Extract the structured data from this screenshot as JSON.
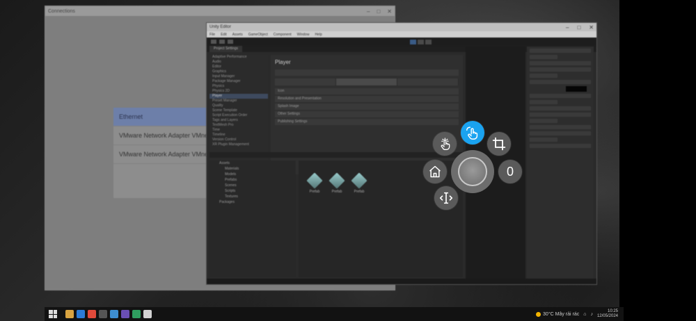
{
  "back_window": {
    "title": "Connections",
    "network_items": [
      {
        "label": "Ethernet",
        "selected": true
      },
      {
        "label": "VMware Network Adapter VMnet1",
        "selected": false
      },
      {
        "label": "VMware Network Adapter VMnet8",
        "selected": false
      }
    ]
  },
  "unity_window": {
    "title": "Unity Editor",
    "menu": [
      "File",
      "Edit",
      "Assets",
      "GameObject",
      "Component",
      "Window",
      "Help"
    ],
    "tabs": [
      "Project Settings"
    ],
    "settings_list": [
      "Adaptive Performance",
      "Audio",
      "Editor",
      "Graphics",
      "Input Manager",
      "Package Manager",
      "Physics",
      "Physics 2D",
      "Player",
      "Preset Manager",
      "Quality",
      "Scene Template",
      "Script Execution Order",
      "Tags and Layers",
      "TextMesh Pro",
      "Time",
      "Timeline",
      "Version Control",
      "XR Plugin Management"
    ],
    "selected_setting": "Player",
    "player_title": "Player",
    "player_sections": [
      "Icon",
      "Resolution and Presentation",
      "Splash Image",
      "Other Settings",
      "Publishing Settings"
    ],
    "hierarchy_rows": [
      "Assets",
      "Materials",
      "Models",
      "Prefabs",
      "Scenes",
      "Scripts",
      "Textures",
      "Packages"
    ],
    "assets": [
      {
        "label": "Prefab"
      },
      {
        "label": "Prefab"
      },
      {
        "label": "Prefab"
      }
    ]
  },
  "radial_menu": {
    "buttons": [
      {
        "name": "tap-gesture",
        "icon": "tap-icon"
      },
      {
        "name": "swipe-gesture",
        "icon": "swipe-hand-icon",
        "active": true
      },
      {
        "name": "crop",
        "icon": "crop-icon"
      },
      {
        "name": "home",
        "icon": "home-icon"
      },
      {
        "name": "counter",
        "icon": "zero-label",
        "label": "0"
      },
      {
        "name": "resize",
        "icon": "text-cursor-icon"
      }
    ],
    "active_color": "#1aa3f0",
    "button_color": "#5a5a5a"
  },
  "taskbar": {
    "weather": "30°C Mây rải rác",
    "time": "10:25",
    "date": "12/05/2024"
  }
}
